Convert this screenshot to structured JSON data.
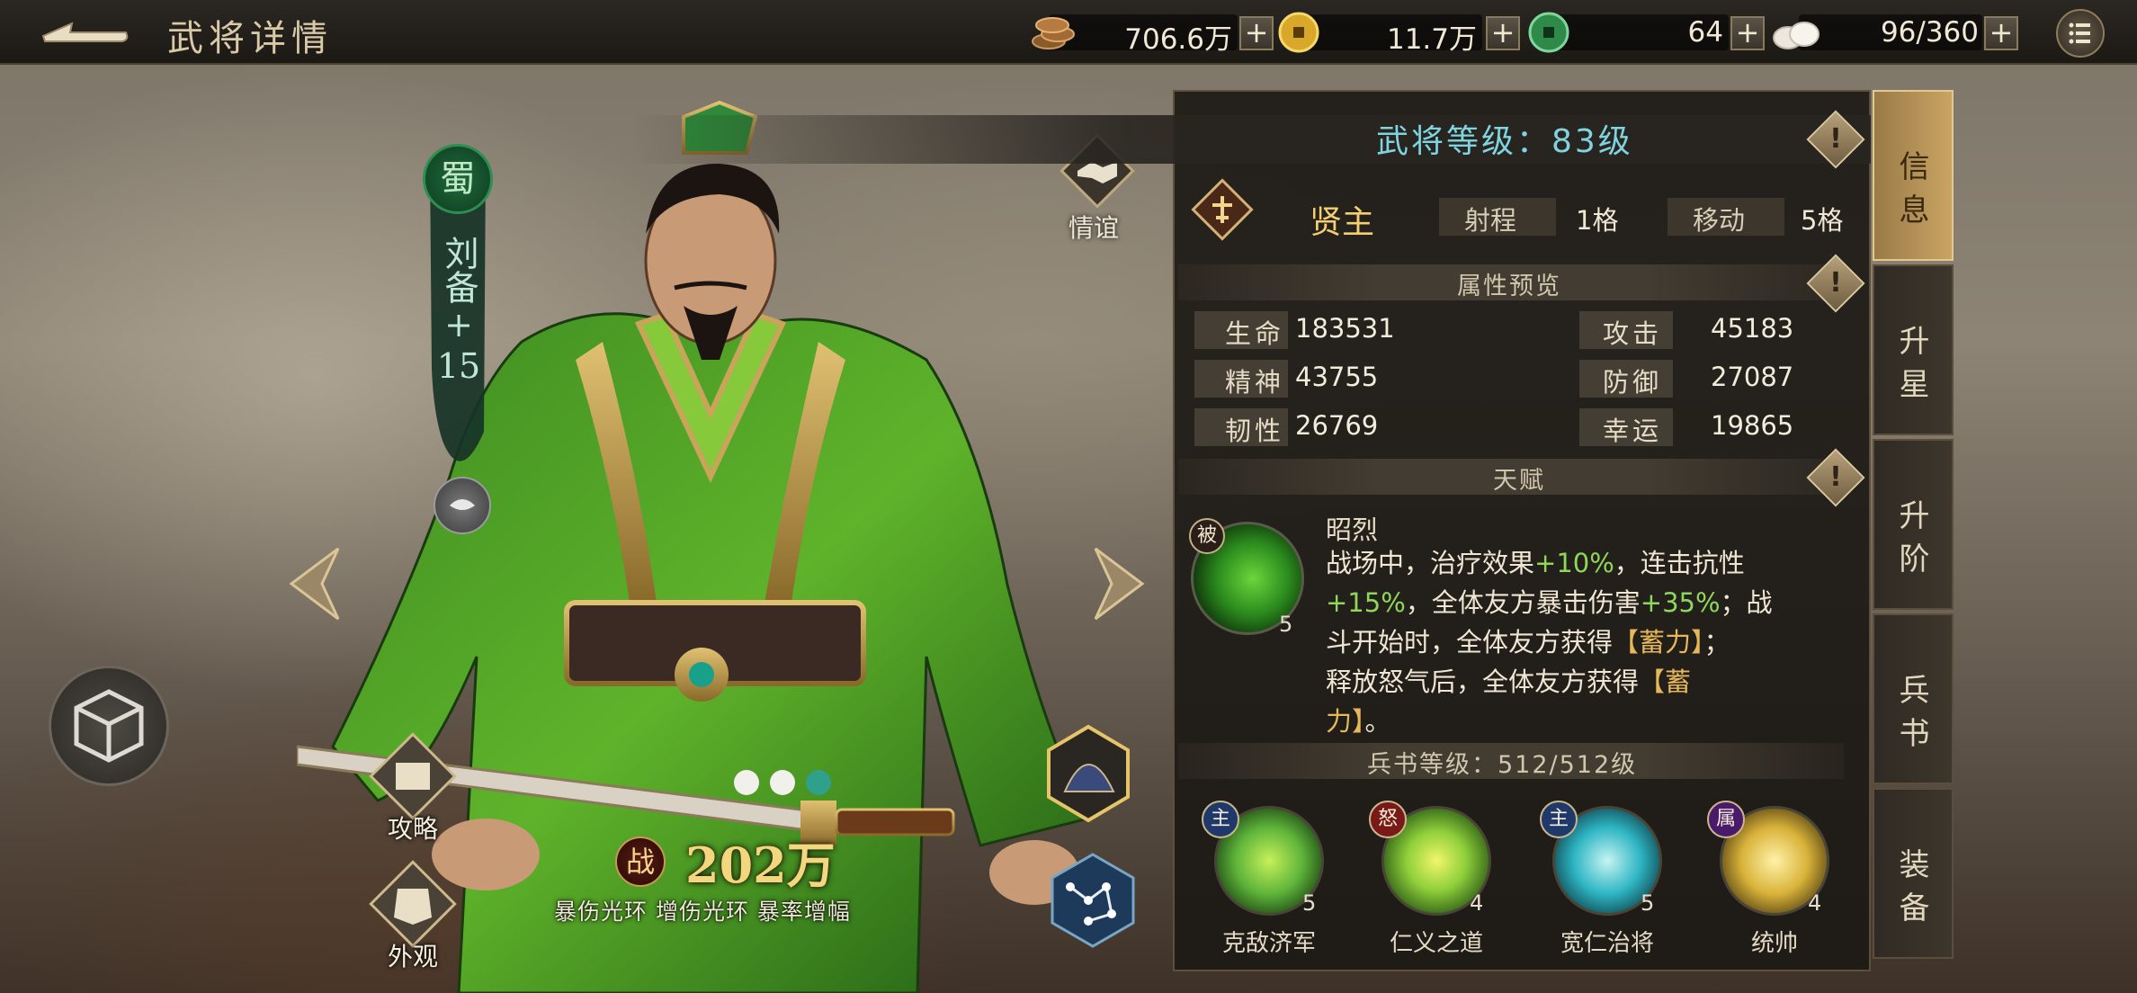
{
  "header": {
    "title": "武将详情",
    "resources": [
      {
        "icon": "coins-icon",
        "value": "706.6万"
      },
      {
        "icon": "gold-coin-icon",
        "value": "11.7万"
      },
      {
        "icon": "jade-coin-icon",
        "value": "64"
      },
      {
        "icon": "stamina-bun-icon",
        "value": "96/360"
      }
    ]
  },
  "hero": {
    "faction": "蜀",
    "name": "刘备",
    "plus": "+",
    "plus_level": "15",
    "friendship_label": "情谊",
    "power_badge": "战",
    "power": "202万",
    "auras": "暴伤光环 增伤光环 暴率增幅",
    "strategy_label": "攻略",
    "appearance_label": "外观"
  },
  "info": {
    "level": "武将等级：83级",
    "role": "贤主",
    "range_label": "射程",
    "range_value": "1格",
    "move_label": "移动",
    "move_value": "5格",
    "attr_title": "属性预览",
    "attributes": [
      {
        "label": "生命",
        "value": "183531"
      },
      {
        "label": "攻击",
        "value": "45183"
      },
      {
        "label": "精神",
        "value": "43755"
      },
      {
        "label": "防御",
        "value": "27087"
      },
      {
        "label": "韧性",
        "value": "26769"
      },
      {
        "label": "幸运",
        "value": "19865"
      }
    ],
    "talent_title": "天赋",
    "talent": {
      "type": "被",
      "level": "5",
      "name": "昭烈",
      "lines": [
        [
          "战场中，治疗效果",
          "+10%",
          "，连击抗性"
        ],
        [
          "+15%",
          "，全体友方暴击伤害",
          "+35%",
          "；战"
        ],
        [
          "斗开始时，全体友方获得",
          "【蓄力】",
          "；"
        ],
        [
          "释放怒气后，全体友方获得",
          "【蓄"
        ],
        [
          "力】",
          "。"
        ]
      ]
    },
    "book_title": "兵书等级：512/512级",
    "books": [
      {
        "tag": "主",
        "level": "5",
        "name": "克敌济军",
        "color": "#5fb53a"
      },
      {
        "tag": "怒",
        "level": "4",
        "name": "仁义之道",
        "color": "#8fd03a"
      },
      {
        "tag": "主",
        "level": "5",
        "name": "宽仁治将",
        "color": "#2fb6c4"
      },
      {
        "tag": "属",
        "level": "4",
        "name": "统帅",
        "color": "#d9b33a"
      }
    ]
  },
  "tabs": [
    "信息",
    "升星",
    "升阶",
    "兵书",
    "装备"
  ]
}
